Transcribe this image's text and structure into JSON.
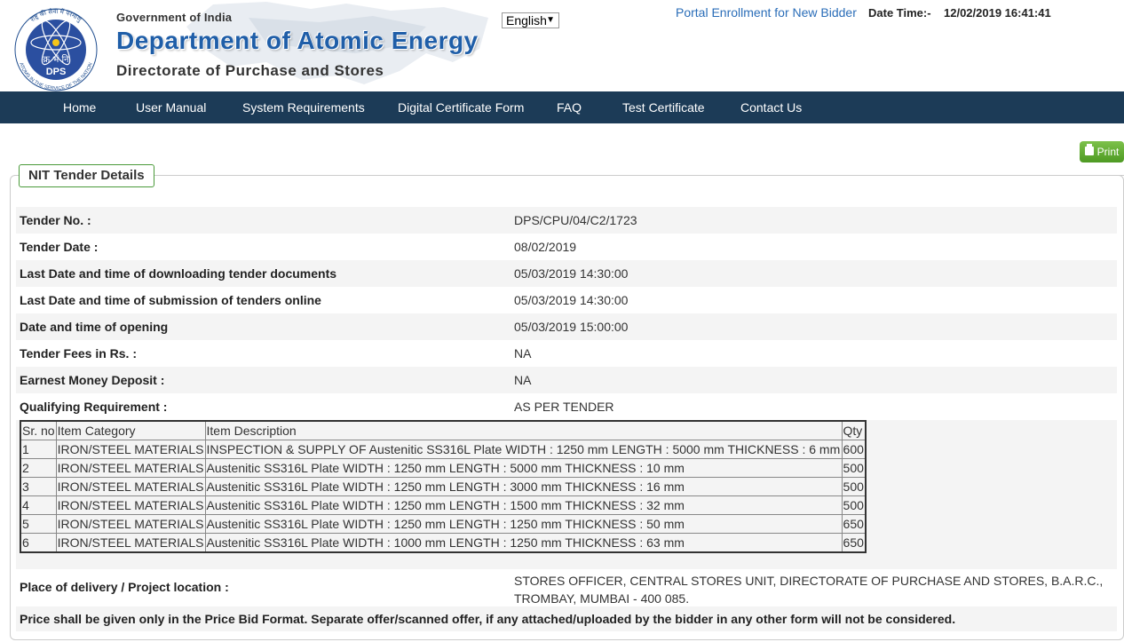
{
  "header": {
    "government": "Government of India",
    "department": "Department of Atomic Energy",
    "directorate": "Directorate of Purchase and Stores",
    "logo_text": "DPS",
    "logo_hindi": "क्र भं नि",
    "logo_ring_top": "राष्ट्र की सेवा में परमाणु",
    "logo_ring_bottom": "ATOMS IN THE SERVICE OF THE NATION",
    "language": "English",
    "portal_link": "Portal Enrollment for New Bidder",
    "datetime_label": "Date Time:-",
    "datetime_value": "12/02/2019 16:41:41"
  },
  "nav": [
    {
      "label": "Home"
    },
    {
      "label": "User Manual"
    },
    {
      "label": "System Requirements"
    },
    {
      "label": "Digital Certificate Form"
    },
    {
      "label": "FAQ"
    },
    {
      "label": "Test Certificate"
    },
    {
      "label": "Contact Us"
    }
  ],
  "print_label": "Print",
  "section_title": "NIT Tender Details",
  "details": [
    {
      "label": "Tender No. :",
      "value": "DPS/CPU/04/C2/1723"
    },
    {
      "label": "Tender Date :",
      "value": "08/02/2019"
    },
    {
      "label": "Last Date and time of downloading tender documents",
      "value": "05/03/2019 14:30:00"
    },
    {
      "label": "Last Date and time of submission of tenders online",
      "value": "05/03/2019 14:30:00"
    },
    {
      "label": "Date and time of opening",
      "value": "05/03/2019 15:00:00"
    },
    {
      "label": "Tender Fees in Rs. :",
      "value": "NA"
    },
    {
      "label": "Earnest Money Deposit :",
      "value": "NA"
    },
    {
      "label": "Qualifying Requirement :",
      "value": "AS PER TENDER"
    }
  ],
  "items_table": {
    "headers": [
      "Sr. no",
      "Item Category",
      "Item Description",
      "Qty"
    ],
    "rows": [
      [
        "1",
        "IRON/STEEL MATERIALS",
        "INSPECTION & SUPPLY OF Austenitic SS316L Plate WIDTH : 1250 mm LENGTH : 5000 mm THICKNESS : 6 mm",
        "600"
      ],
      [
        "2",
        "IRON/STEEL MATERIALS",
        "Austenitic SS316L Plate WIDTH : 1250 mm LENGTH : 5000 mm THICKNESS : 10 mm",
        "500"
      ],
      [
        "3",
        "IRON/STEEL MATERIALS",
        "Austenitic SS316L Plate WIDTH : 1250 mm LENGTH : 3000 mm THICKNESS : 16 mm",
        "500"
      ],
      [
        "4",
        "IRON/STEEL MATERIALS",
        "Austenitic SS316L Plate WIDTH : 1250 mm LENGTH : 1500 mm THICKNESS : 32 mm",
        "500"
      ],
      [
        "5",
        "IRON/STEEL MATERIALS",
        "Austenitic SS316L Plate WIDTH : 1250 mm LENGTH : 1250 mm THICKNESS : 50 mm",
        "650"
      ],
      [
        "6",
        "IRON/STEEL MATERIALS",
        "Austenitic SS316L Plate WIDTH : 1000 mm LENGTH : 1250 mm THICKNESS : 63 mm",
        "650"
      ]
    ]
  },
  "place": {
    "label": "Place of delivery / Project location :",
    "value": "STORES OFFICER, CENTRAL STORES UNIT, DIRECTORATE OF PURCHASE AND STORES, B.A.R.C., TROMBAY, MUMBAI - 400 085."
  },
  "note": "Price shall be given only in the Price Bid Format. Separate offer/scanned offer, if any attached/uploaded by the bidder in any other form will not be considered.",
  "colors": {
    "nav_bg": "#1c3b57",
    "title_blue": "#1f5ea8",
    "link_blue": "#2a6db8",
    "print_green": "#5aa82e"
  }
}
